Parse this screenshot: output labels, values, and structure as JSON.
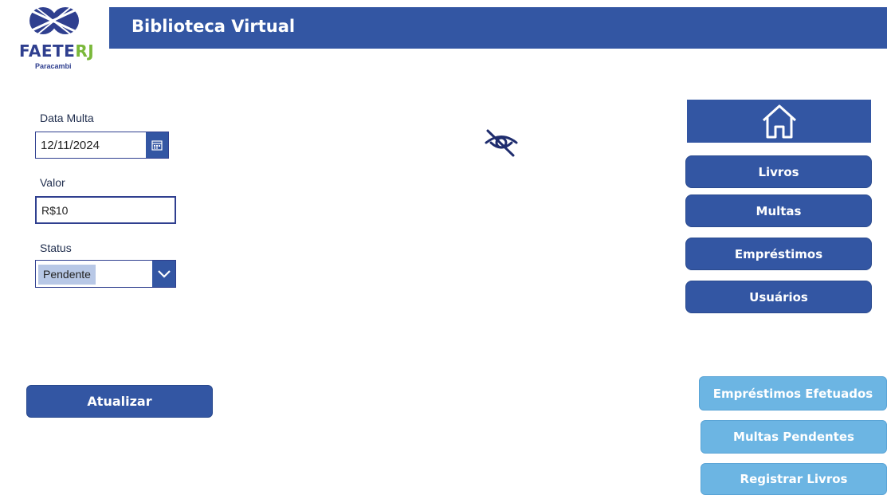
{
  "logo": {
    "main": "FAETE",
    "accent": "RJ",
    "subtitle": "Paracambi"
  },
  "header": {
    "title": "Biblioteca Virtual"
  },
  "form": {
    "date_label": "Data Multa",
    "date_value": "12/11/2024",
    "valor_label": "Valor",
    "valor_value": "R$10",
    "status_label": "Status",
    "status_value": "Pendente"
  },
  "actions": {
    "update_label": "Atualizar"
  },
  "nav": {
    "items": [
      {
        "label": "Livros"
      },
      {
        "label": "Multas"
      },
      {
        "label": "Empréstimos"
      },
      {
        "label": "Usuários"
      }
    ]
  },
  "reports": {
    "items": [
      {
        "label": "Empréstimos Efetuados"
      },
      {
        "label": "Multas Pendentes"
      },
      {
        "label": "Registrar Livros"
      }
    ]
  },
  "icons": {
    "logo": "faeterj-logo-icon",
    "calendar": "calendar-icon",
    "chevron": "chevron-down-icon",
    "eye": "eye-off-icon",
    "home": "home-icon"
  },
  "colors": {
    "primary": "#3356a3",
    "secondary": "#6cb5e3",
    "accent_green": "#7ab83a"
  }
}
